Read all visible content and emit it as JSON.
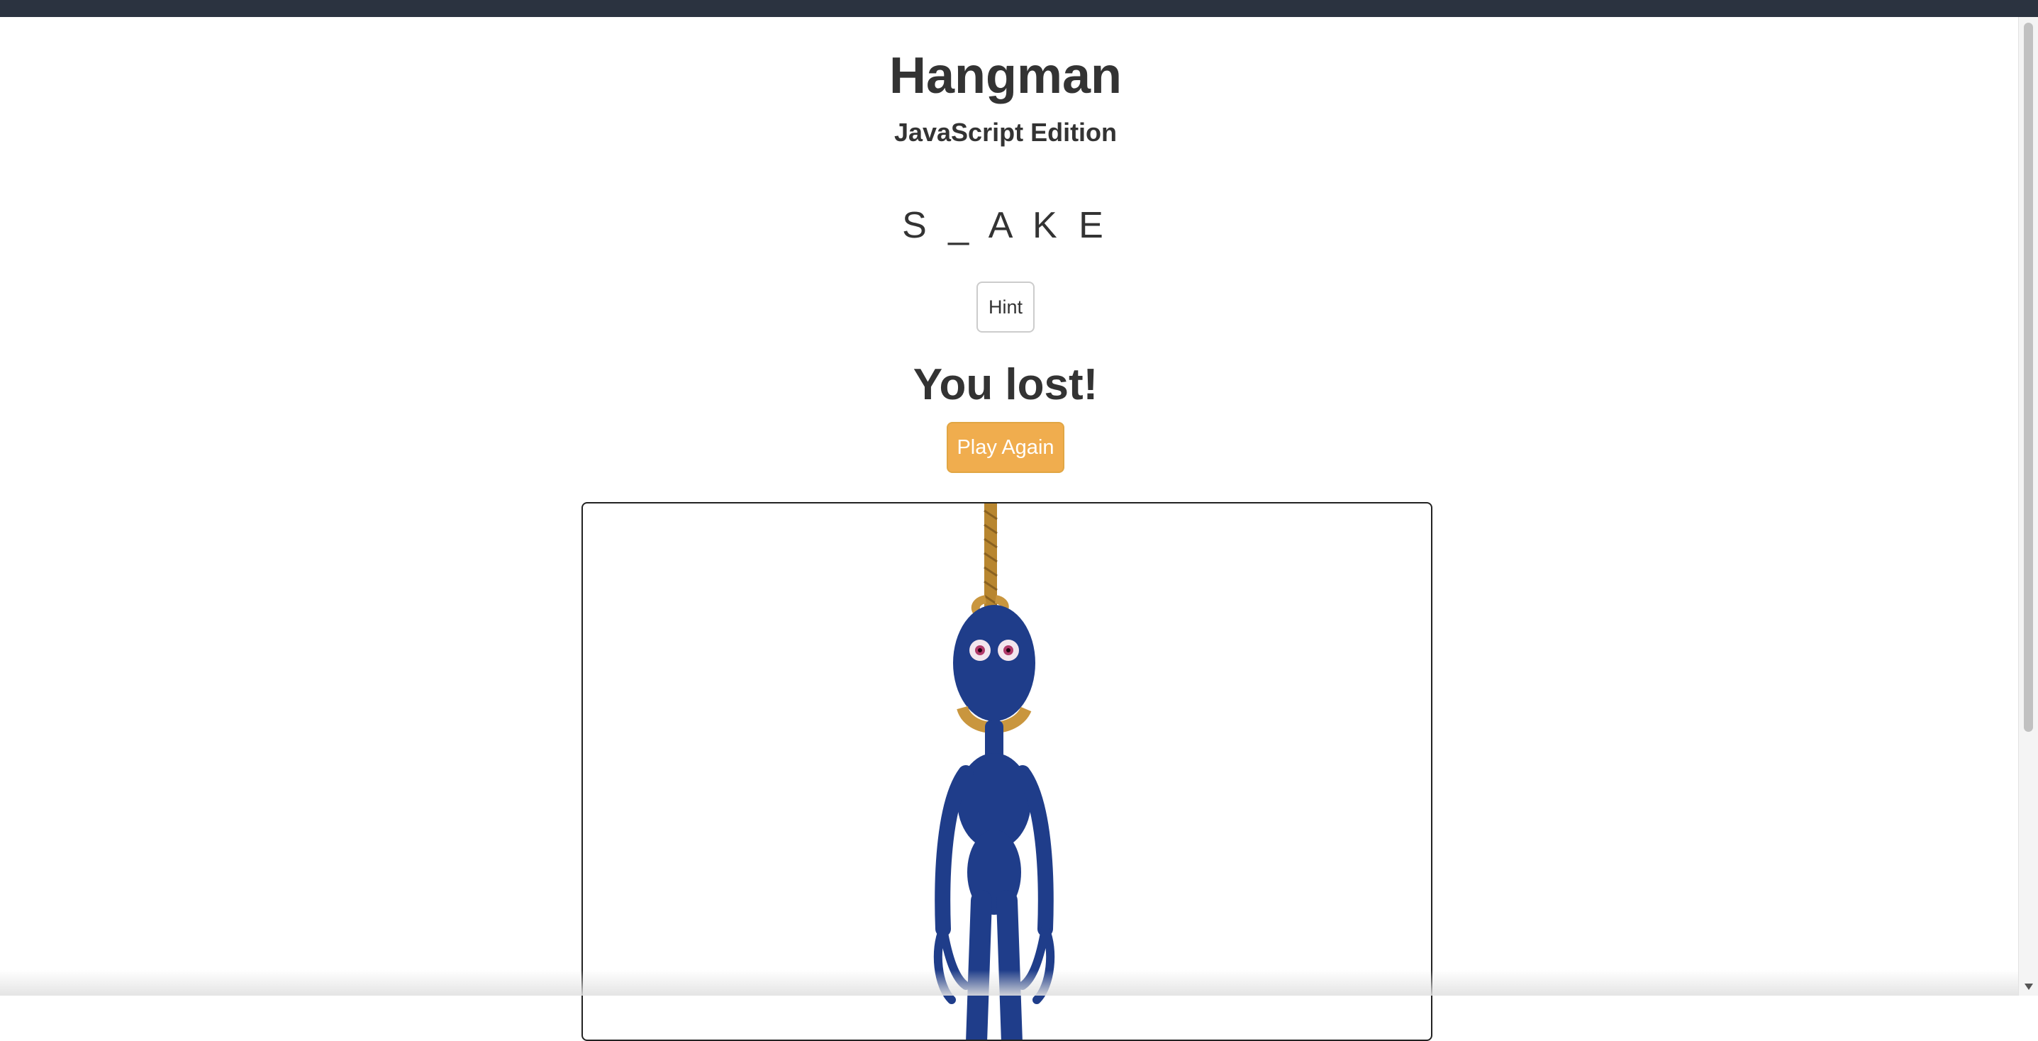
{
  "header": {
    "title": "Hangman",
    "subtitle": "JavaScript Edition"
  },
  "game": {
    "word_display": "S _ A K E",
    "hint_label": "Hint",
    "result_text": "You lost!",
    "play_again_label": "Play Again"
  },
  "colors": {
    "play_again_button": "#f0ad4e",
    "figure_body": "#1f3d8a",
    "rope": "#c9963e"
  },
  "icons": {
    "hangman_figure": "hanged-blue-figure"
  }
}
